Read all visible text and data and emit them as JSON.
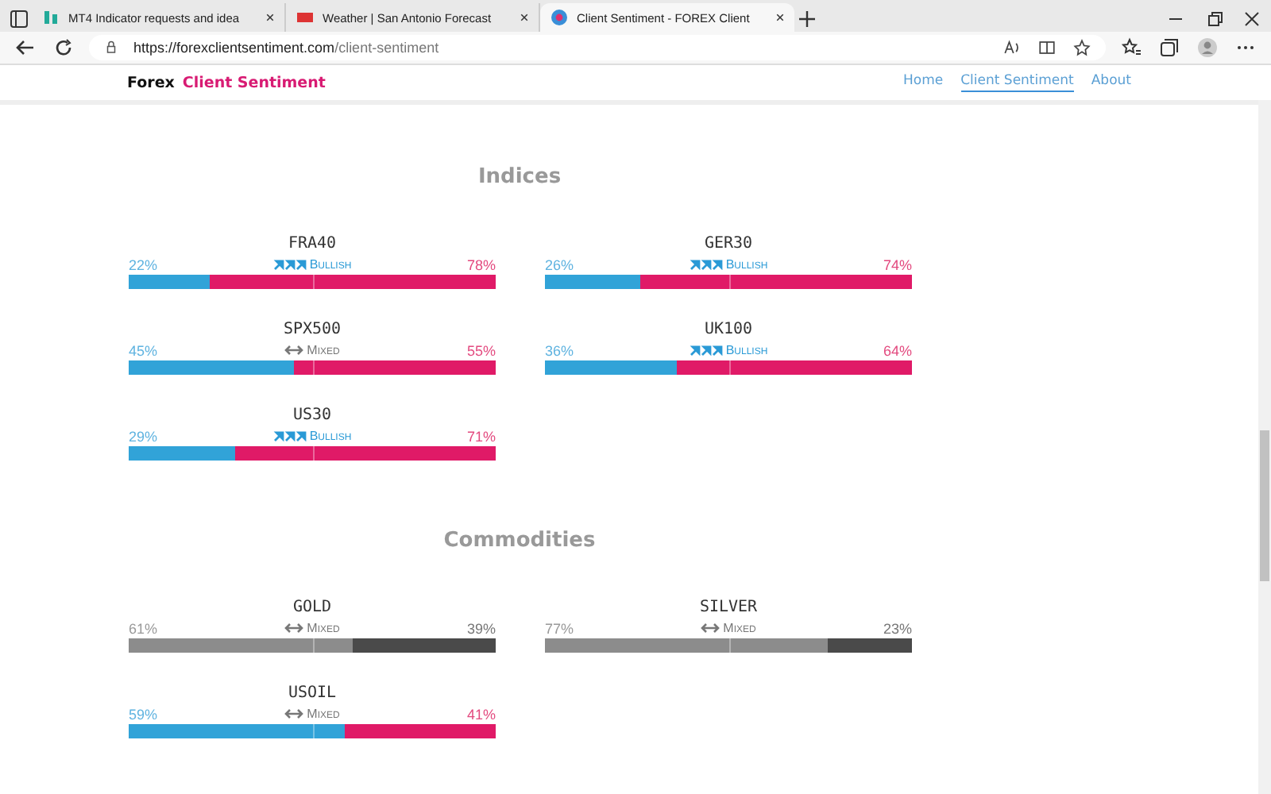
{
  "browser": {
    "tabs": [
      {
        "title": "MT4 Indicator requests and idea",
        "selected": false
      },
      {
        "title": "Weather | San Antonio Forecast",
        "selected": false
      },
      {
        "title": "Client Sentiment - FOREX Client",
        "selected": true
      }
    ],
    "url_host": "https://forexclientsentiment.com",
    "url_path": "/client-sentiment"
  },
  "site": {
    "brand": "Forex",
    "brand_accent": "Client Sentiment",
    "nav": [
      {
        "label": "Home",
        "selected": false
      },
      {
        "label": "Client Sentiment",
        "selected": true
      },
      {
        "label": "About",
        "selected": false
      }
    ]
  },
  "sections": [
    {
      "title": "Indices",
      "cards": [
        {
          "symbol": "FRA40",
          "long": "22%",
          "short": "78%",
          "level": 0.22,
          "sentiment": "Bullish",
          "kind": "bullish",
          "muted": false
        },
        {
          "symbol": "GER30",
          "long": "26%",
          "short": "74%",
          "level": 0.26,
          "sentiment": "Bullish",
          "kind": "bullish",
          "muted": false
        },
        {
          "symbol": "SPX500",
          "long": "45%",
          "short": "55%",
          "level": 0.45,
          "sentiment": "Mixed",
          "kind": "mixed",
          "muted": false
        },
        {
          "symbol": "UK100",
          "long": "36%",
          "short": "64%",
          "level": 0.36,
          "sentiment": "Bullish",
          "kind": "bullish",
          "muted": false
        },
        {
          "symbol": "US30",
          "long": "29%",
          "short": "71%",
          "level": 0.29,
          "sentiment": "Bullish",
          "kind": "bullish",
          "muted": false
        }
      ]
    },
    {
      "title": "Commodities",
      "cards": [
        {
          "symbol": "GOLD",
          "long": "61%",
          "short": "39%",
          "level": 0.61,
          "sentiment": "Mixed",
          "kind": "mixed",
          "muted": true
        },
        {
          "symbol": "SILVER",
          "long": "77%",
          "short": "23%",
          "level": 0.77,
          "sentiment": "Mixed",
          "kind": "mixed",
          "muted": true
        },
        {
          "symbol": "USOIL",
          "long": "59%",
          "short": "41%",
          "level": 0.59,
          "sentiment": "Mixed",
          "kind": "mixed",
          "muted": false
        }
      ]
    }
  ]
}
